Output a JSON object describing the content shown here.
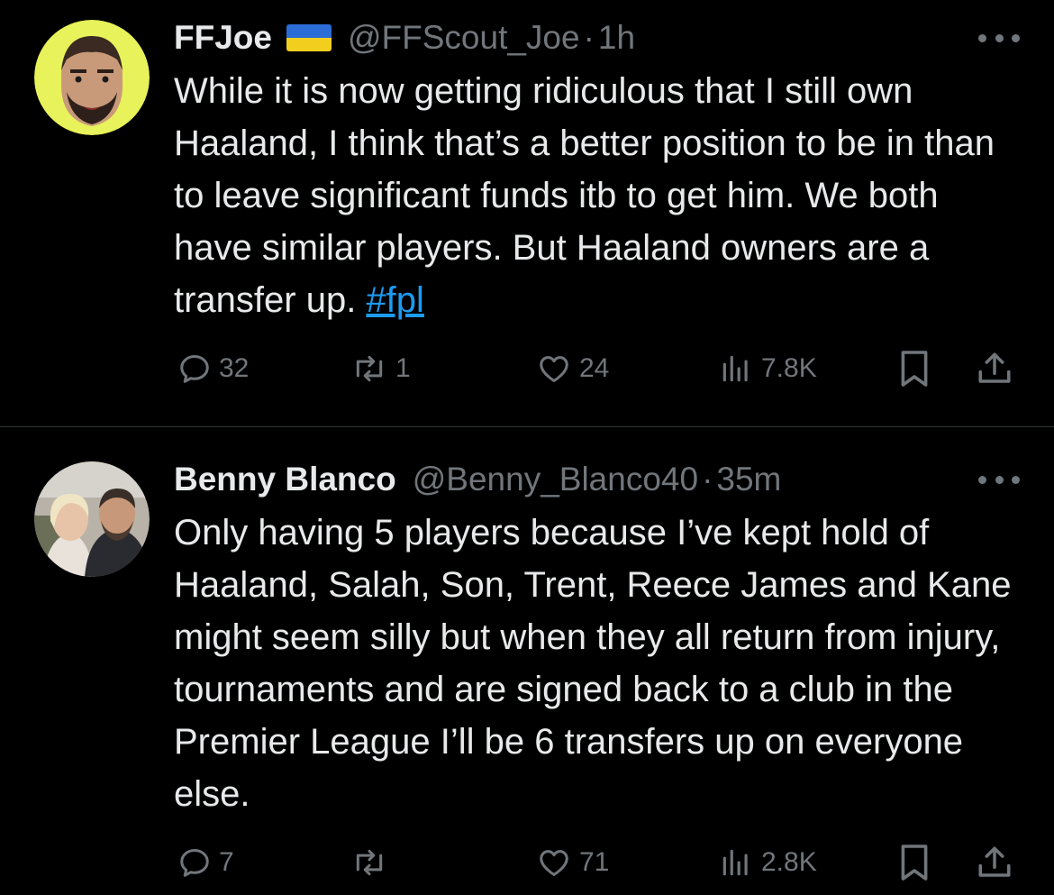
{
  "tweets": [
    {
      "name": "FFJoe",
      "handle": "@FFScout_Joe",
      "separator": "·",
      "time": "1h",
      "text_before": "While it is now getting ridiculous that I still own Haaland, I think that’s a better position to be in than to leave significant funds itb to get him. We both have similar players. But Haaland owners are a transfer up. ",
      "hashtag": "#fpl",
      "replies": "32",
      "reposts": "1",
      "likes": "24",
      "views": "7.8K",
      "avatar_icon": "cartoon-bearded-man-icon",
      "flag_icon": "ukraine-flag-icon"
    },
    {
      "name": "Benny Blanco",
      "handle": "@Benny_Blanco40",
      "separator": "·",
      "time": "35m",
      "text": "Only having 5 players because I’ve kept hold of Haaland, Salah, Son, Trent, Reece James and Kane might seem silly but when they all return from injury, tournaments and are signed back to a club in the Premier League I’ll be 6 transfers up on everyone else.",
      "replies": "7",
      "reposts": "",
      "likes": "71",
      "views": "2.8K",
      "avatar_icon": "couple-photo-avatar"
    }
  ],
  "colors": {
    "background": "#000000",
    "text": "#e7e9ea",
    "muted": "#71767b",
    "link": "#1d9bf0",
    "divider": "#2f3336"
  }
}
